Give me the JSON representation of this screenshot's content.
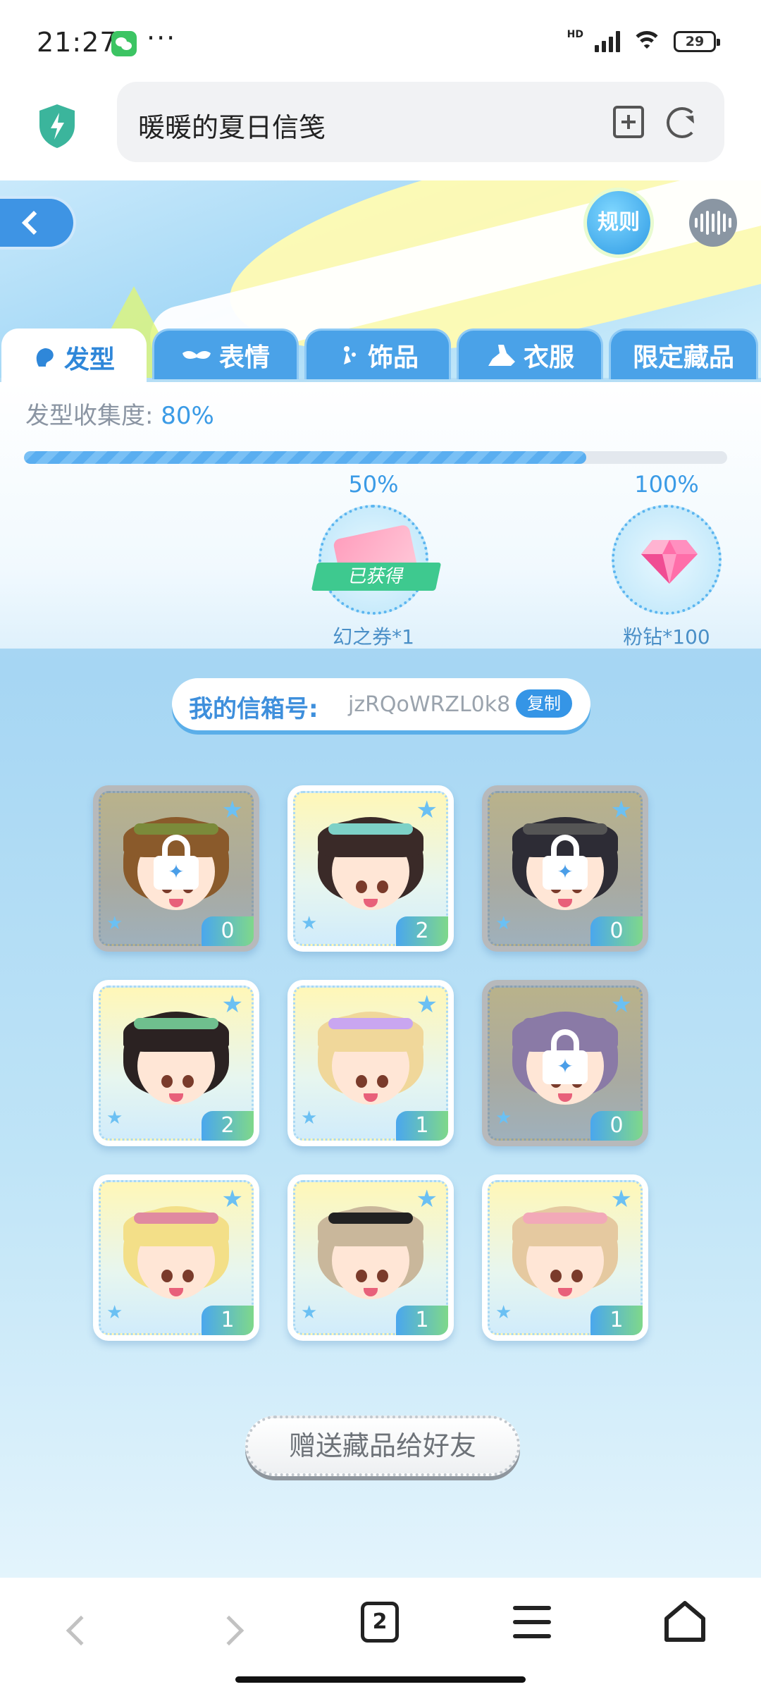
{
  "status_bar": {
    "time": "21:27",
    "more": "···",
    "network": "HD",
    "battery": "29",
    "icons": [
      "wechat-icon",
      "signal-icon",
      "wifi-icon",
      "battery-icon"
    ]
  },
  "browser": {
    "page_title": "暖暖的夏日信笺",
    "icons": [
      "shield-icon",
      "add-bookmark-icon",
      "reload-icon"
    ]
  },
  "game": {
    "rule_label": "规则",
    "tabs": [
      {
        "label": "发型",
        "icon": "hair-icon",
        "active": true
      },
      {
        "label": "表情",
        "icon": "mask-icon",
        "active": false
      },
      {
        "label": "饰品",
        "icon": "earring-icon",
        "active": false
      },
      {
        "label": "衣服",
        "icon": "clothes-icon",
        "active": false
      },
      {
        "label": "限定藏品",
        "icon": "",
        "active": false
      }
    ],
    "collection": {
      "label": "发型收集度:",
      "percent_text": "80%",
      "progress": 0.8
    },
    "milestones": [
      {
        "percent": "50%",
        "reward": "幻之券*1",
        "status": "已获得",
        "icon": "ticket-icon"
      },
      {
        "percent": "100%",
        "reward": "粉钻*100",
        "status": "",
        "icon": "pink-diamond-icon"
      }
    ],
    "mailbox": {
      "label": "我的信箱号:",
      "code": "jzRQoWRZL0k8",
      "copy_label": "复制"
    },
    "items": [
      {
        "count": "0",
        "locked": true,
        "hair_color": "#8a5a2b",
        "accent": "#7b8a3a"
      },
      {
        "count": "2",
        "locked": false,
        "hair_color": "#3a2a28",
        "accent": "#7dd1c7"
      },
      {
        "count": "0",
        "locked": true,
        "hair_color": "#2d2c35",
        "accent": "#555"
      },
      {
        "count": "2",
        "locked": false,
        "hair_color": "#2b2222",
        "accent": "#6fbf8e"
      },
      {
        "count": "1",
        "locked": false,
        "hair_color": "#f0d79a",
        "accent": "#c9a6f0"
      },
      {
        "count": "0",
        "locked": true,
        "hair_color": "#8a7aa6",
        "accent": "#8a7aa6"
      },
      {
        "count": "1",
        "locked": false,
        "hair_color": "#f3df88",
        "accent": "#e08aa0"
      },
      {
        "count": "1",
        "locked": false,
        "hair_color": "#c9b79b",
        "accent": "#222222"
      },
      {
        "count": "1",
        "locked": false,
        "hair_color": "#e5c9a0",
        "accent": "#f2a9b8"
      }
    ],
    "gift_button": "赠送藏品给好友",
    "colors": {
      "accent": "#3b9be6",
      "tab_bg": "#4aa2e8",
      "count_badge": "#4aa7ee"
    }
  },
  "bottom_nav": {
    "tab_count": "2",
    "icons": [
      "back-icon",
      "forward-icon",
      "tabs-icon",
      "menu-icon",
      "home-icon"
    ]
  }
}
